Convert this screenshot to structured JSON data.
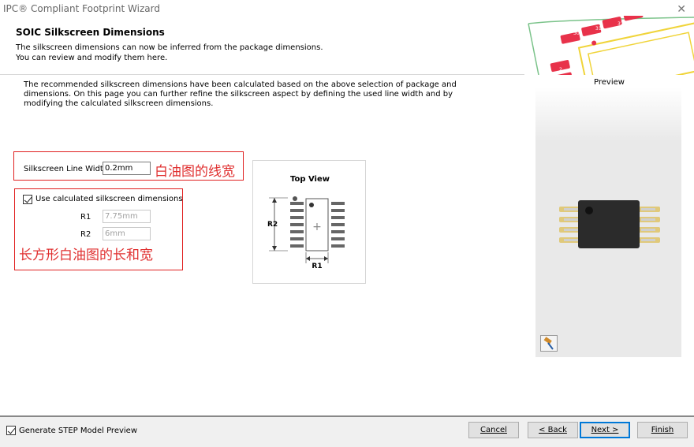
{
  "window": {
    "title": "IPC® Compliant Footprint Wizard",
    "close_glyph": "✕"
  },
  "header": {
    "title": "SOIC Silkscreen Dimensions",
    "desc_line1": "The silkscreen dimensions can now be inferred from the package dimensions.",
    "desc_line2": "You can review and modify them here."
  },
  "intro_text": "The recommended silkscreen dimensions have been calculated based on the above selection of package and dimensions. On this page you can further refine the silkscreen aspect by defining the used line width and by modifying the calculated silkscreen dimensions.",
  "line_width": {
    "label": "Silkscreen Line Width",
    "value": "0.2mm"
  },
  "annotation1": "白油图的线宽",
  "use_calculated": {
    "label": "Use calculated silkscreen dimensions",
    "checked": true
  },
  "r1": {
    "label": "R1",
    "value": "7.75mm"
  },
  "r2": {
    "label": "R2",
    "value": "6mm"
  },
  "annotation2": "长方形白油图的长和宽",
  "top_view": {
    "title": "Top View",
    "r1_label": "R1",
    "r2_label": "R2",
    "plus": "+"
  },
  "preview": {
    "label": "Preview"
  },
  "header_pads": [
    "30",
    "31",
    "32",
    "1",
    "2",
    "3",
    "4"
  ],
  "footer": {
    "step_preview_label": "Generate STEP Model Preview",
    "step_checked": true,
    "cancel": "Cancel",
    "back": "< Back",
    "next": "Next >",
    "finish": "Finish"
  },
  "colors": {
    "annotation": "#e03030",
    "pad": "#e8324a",
    "accent": "#0078d7"
  }
}
